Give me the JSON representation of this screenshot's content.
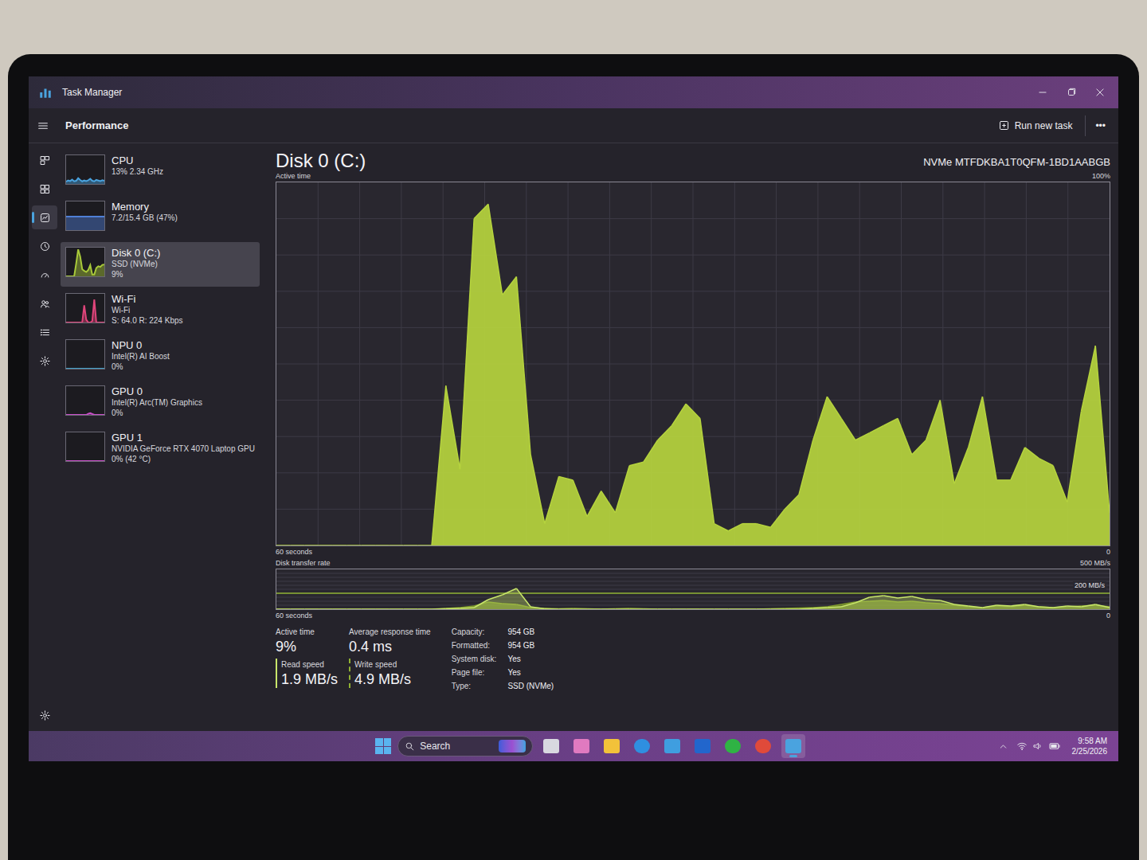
{
  "window": {
    "title": "Task Manager"
  },
  "header": {
    "title": "Performance",
    "run_new_task": "Run new task",
    "more": "•••"
  },
  "nav": [
    {
      "selected": false
    },
    {
      "selected": false
    },
    {
      "selected": true
    },
    {
      "selected": false
    },
    {
      "selected": false
    },
    {
      "selected": false
    },
    {
      "selected": false
    },
    {
      "selected": false
    }
  ],
  "devices": [
    {
      "name": "CPU",
      "line1": "13% 2.34 GHz",
      "line2": "",
      "selected": false,
      "color": "#4aa3df",
      "values": [
        8,
        12,
        10,
        15,
        9,
        11,
        20,
        14,
        9,
        12,
        10,
        13,
        18,
        11,
        9,
        14,
        12,
        10,
        13,
        11
      ]
    },
    {
      "name": "Memory",
      "line1": "7.2/15.4 GB (47%)",
      "line2": "",
      "selected": false,
      "color": "#4f7fd6",
      "values": [
        47,
        47,
        47,
        47,
        47,
        47,
        47,
        47,
        47,
        47,
        47,
        47,
        47,
        47,
        47,
        47,
        47,
        47,
        47,
        47
      ]
    },
    {
      "name": "Disk 0 (C:)",
      "line1": "SSD (NVMe)",
      "line2": "9%",
      "selected": true,
      "color": "#a8c93a",
      "values": [
        0,
        0,
        0,
        0,
        0,
        44,
        94,
        69,
        25,
        19,
        15,
        22,
        39,
        6,
        6,
        29,
        35,
        33,
        40,
        41
      ]
    },
    {
      "name": "Wi-Fi",
      "line1": "Wi-Fi",
      "line2": "S: 64.0  R: 224 Kbps",
      "selected": false,
      "color": "#e0457b",
      "values": [
        0,
        0,
        0,
        0,
        0,
        0,
        0,
        0,
        0,
        60,
        10,
        0,
        0,
        5,
        80,
        0,
        0,
        0,
        0,
        0
      ]
    },
    {
      "name": "NPU 0",
      "line1": "Intel(R) AI Boost",
      "line2": "0%",
      "selected": false,
      "color": "#3fa0c8",
      "values": [
        0,
        0,
        0,
        0,
        0,
        0,
        0,
        0,
        0,
        0,
        0,
        0,
        0,
        0,
        0,
        0,
        0,
        0,
        0,
        0
      ]
    },
    {
      "name": "GPU 0",
      "line1": "Intel(R) Arc(TM) Graphics",
      "line2": "0%",
      "selected": false,
      "color": "#c94fc9",
      "values": [
        0,
        0,
        0,
        0,
        0,
        0,
        0,
        0,
        0,
        0,
        0,
        4,
        6,
        3,
        0,
        0,
        0,
        0,
        0,
        0
      ]
    },
    {
      "name": "GPU 1",
      "line1": "NVIDIA GeForce RTX 4070 Laptop GPU",
      "line2": "0% (42 °C)",
      "selected": false,
      "color": "#c94fc9",
      "values": [
        0,
        0,
        0,
        0,
        0,
        0,
        0,
        0,
        0,
        0,
        0,
        0,
        0,
        0,
        0,
        0,
        0,
        0,
        0,
        0
      ]
    }
  ],
  "detail": {
    "title": "Disk 0 (C:)",
    "model": "NVMe MTFDKBA1T0QFM-1BD1AABGB",
    "active_chart": {
      "label": "Active time",
      "max": "100%",
      "left": "60 seconds",
      "right": "0",
      "values": [
        0,
        0,
        0,
        0,
        0,
        0,
        0,
        0,
        0,
        0,
        0,
        0,
        44,
        21,
        90,
        94,
        69,
        74,
        25,
        6,
        19,
        18,
        8,
        15,
        9,
        22,
        23,
        29,
        33,
        39,
        35,
        6,
        4,
        6,
        6,
        5,
        10,
        14,
        29,
        41,
        35,
        29,
        31,
        33,
        35,
        25,
        29,
        40,
        17,
        27,
        41,
        18,
        18,
        27,
        24,
        22,
        12,
        37,
        55,
        9
      ]
    },
    "transfer_chart": {
      "label": "Disk transfer rate",
      "max": "500 MB/s",
      "mid": "200 MB/s",
      "left": "60 seconds",
      "right": "0",
      "read": [
        0,
        0,
        0,
        0,
        0,
        0,
        0,
        0,
        0,
        0,
        0,
        0,
        5,
        10,
        20,
        120,
        180,
        260,
        30,
        5,
        0,
        0,
        0,
        0,
        0,
        0,
        0,
        0,
        0,
        0,
        0,
        0,
        0,
        0,
        0,
        0,
        0,
        0,
        10,
        20,
        30,
        80,
        150,
        170,
        140,
        160,
        120,
        110,
        60,
        40,
        20,
        50,
        40,
        60,
        30,
        20,
        40,
        30,
        60,
        20
      ],
      "write": [
        0,
        0,
        0,
        0,
        0,
        0,
        0,
        0,
        0,
        0,
        0,
        0,
        10,
        20,
        40,
        90,
        70,
        60,
        20,
        10,
        5,
        10,
        5,
        0,
        5,
        10,
        5,
        0,
        0,
        0,
        0,
        0,
        0,
        0,
        0,
        5,
        10,
        15,
        20,
        30,
        60,
        90,
        100,
        110,
        90,
        100,
        80,
        70,
        50,
        30,
        20,
        40,
        30,
        50,
        30,
        20,
        30,
        40,
        50,
        30
      ]
    },
    "stats": [
      {
        "label": "Active time",
        "value": "9%"
      },
      {
        "label": "Average response time",
        "value": "0.4 ms"
      },
      {
        "label": "Read speed",
        "value": "1.9 MB/s"
      },
      {
        "label": "Write speed",
        "value": "4.9 MB/s"
      }
    ],
    "properties": [
      {
        "label": "Capacity:",
        "value": "954 GB"
      },
      {
        "label": "Formatted:",
        "value": "954 GB"
      },
      {
        "label": "System disk:",
        "value": "Yes"
      },
      {
        "label": "Page file:",
        "value": "Yes"
      },
      {
        "label": "Type:",
        "value": "SSD (NVMe)"
      }
    ]
  },
  "taskbar": {
    "search": "Search",
    "time": "9:58 AM",
    "date": "2/25/2026",
    "apps": [
      {
        "selected": false
      },
      {
        "selected": false
      },
      {
        "selected": false
      },
      {
        "selected": false
      },
      {
        "selected": false
      },
      {
        "selected": false
      },
      {
        "selected": false
      },
      {
        "selected": false
      },
      {
        "selected": true
      }
    ]
  }
}
